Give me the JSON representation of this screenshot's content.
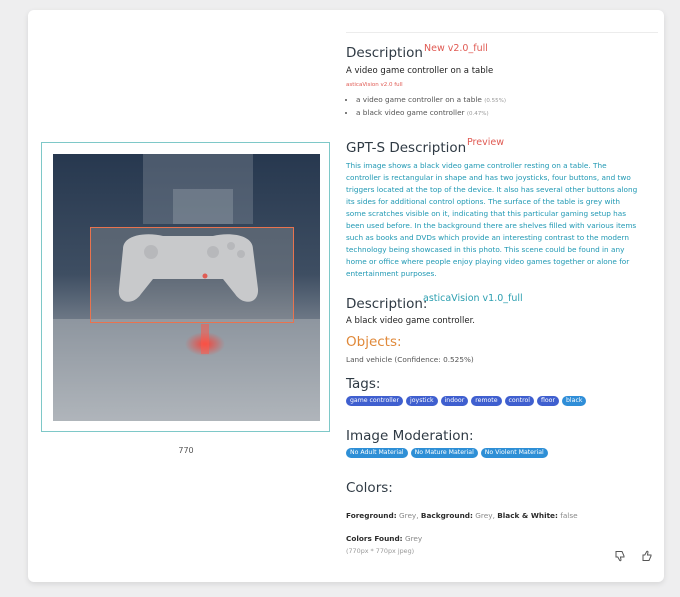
{
  "image_panel": {
    "size_caption": "770"
  },
  "description_v2": {
    "title": "Description",
    "badge": "New v2.0_full",
    "caption": "A video game controller on a table",
    "model_label": "asticaVision v2.0 full",
    "alternatives": [
      {
        "text": "a video game controller on a table",
        "confidence": "(0.55%)"
      },
      {
        "text": "a black video game controller",
        "confidence": "(0.47%)"
      }
    ]
  },
  "gpt_description": {
    "title": "GPT-S Description",
    "badge": "Preview",
    "text": "This image shows a black video game controller resting on a table. The controller is rectangular in shape and has two joysticks, four buttons, and two triggers located at the top of the device. It also has several other buttons along its sides for additional control options. The surface of the table is grey with some scratches visible on it, indicating that this particular gaming setup has been used before. In the background there are shelves filled with various items such as books and DVDs which provide an interesting contrast to the modern technology being showcased in this photo. This scene could be found in any home or office where people enjoy playing video games together or alone for entertainment purposes."
  },
  "description_v1": {
    "title": "Description:",
    "badge": "asticaVision v1.0_full",
    "caption": "A black video game controller."
  },
  "objects": {
    "title": "Objects:",
    "line": "Land vehicle (Confidence: 0.525%)"
  },
  "tags": {
    "title": "Tags:",
    "items": [
      "game controller",
      "joystick",
      "indoor",
      "remote",
      "control",
      "floor",
      "black"
    ]
  },
  "moderation": {
    "title": "Image Moderation:",
    "items": [
      "No Adult Material",
      "No Mature Material",
      "No Violent Material"
    ]
  },
  "colors": {
    "title": "Colors:",
    "foreground_label": "Foreground:",
    "foreground_value": "Grey,",
    "background_label": "Background:",
    "background_value": "Grey,",
    "bw_label": "Black & White:",
    "bw_value": "false",
    "found_label": "Colors Found:",
    "found_value": "Grey",
    "dimensions": "(770px * 770px jpeg)"
  },
  "feedback": {
    "thumbs_down_icon": "thumbs-down-icon",
    "thumbs_up_icon": "thumbs-up-icon"
  },
  "accent_colors": {
    "red_badge": "#e05a53",
    "teal": "#2c9fb0",
    "orange": "#e0893a",
    "tag_blue": "#3f5fcf",
    "moderation_blue": "#2e8fd6"
  }
}
